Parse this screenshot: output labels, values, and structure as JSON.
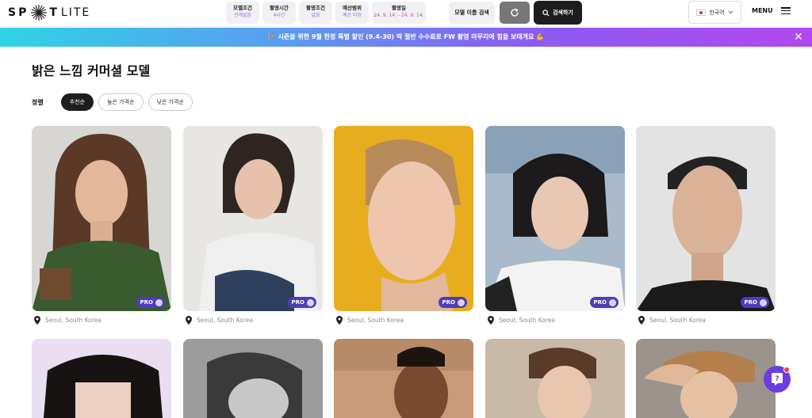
{
  "header": {
    "logo_left": "SP",
    "logo_right": "T",
    "logo_suffix": "LITE",
    "filters": [
      {
        "label": "모델조건",
        "value": "관계없음"
      },
      {
        "label": "촬영시간",
        "value": "4시간"
      },
      {
        "label": "촬영조건",
        "value": "없음"
      },
      {
        "label": "예산범위",
        "value": "예산 미정"
      },
      {
        "label": "촬영일",
        "value": "24. 9. 14. - 24. 9. 14."
      }
    ],
    "name_search": "모델 이름 검색",
    "search_button": "검색하기",
    "language": "한국어",
    "menu": "MENU"
  },
  "banner": {
    "text": "🏁 시즌을 위한 9월 한정 특별 할인 (9.4-30) 딱 절반 수수료로 FW 촬영 마무리에 힘을 보태게요 💪"
  },
  "page_title": "밝은 느낌 커머셜 모델",
  "sort": {
    "label": "정렬",
    "options": [
      "추천순",
      "높은 가격순",
      "낮은 가격순"
    ]
  },
  "cards": [
    {
      "badge": "PRO",
      "location": "Seoul, South Korea"
    },
    {
      "badge": "PRO",
      "location": "Seoul, South Korea"
    },
    {
      "badge": "PRO",
      "location": "Seoul, South Korea"
    },
    {
      "badge": "PRO",
      "location": "Seoul, South Korea"
    },
    {
      "badge": "PRO",
      "location": "Seoul, South Korea"
    }
  ],
  "colors": {
    "accent": "#4f3cb8",
    "banner_start": "#2ed3e6",
    "banner_end": "#b148ee",
    "help_button": "#6c3ee0"
  }
}
